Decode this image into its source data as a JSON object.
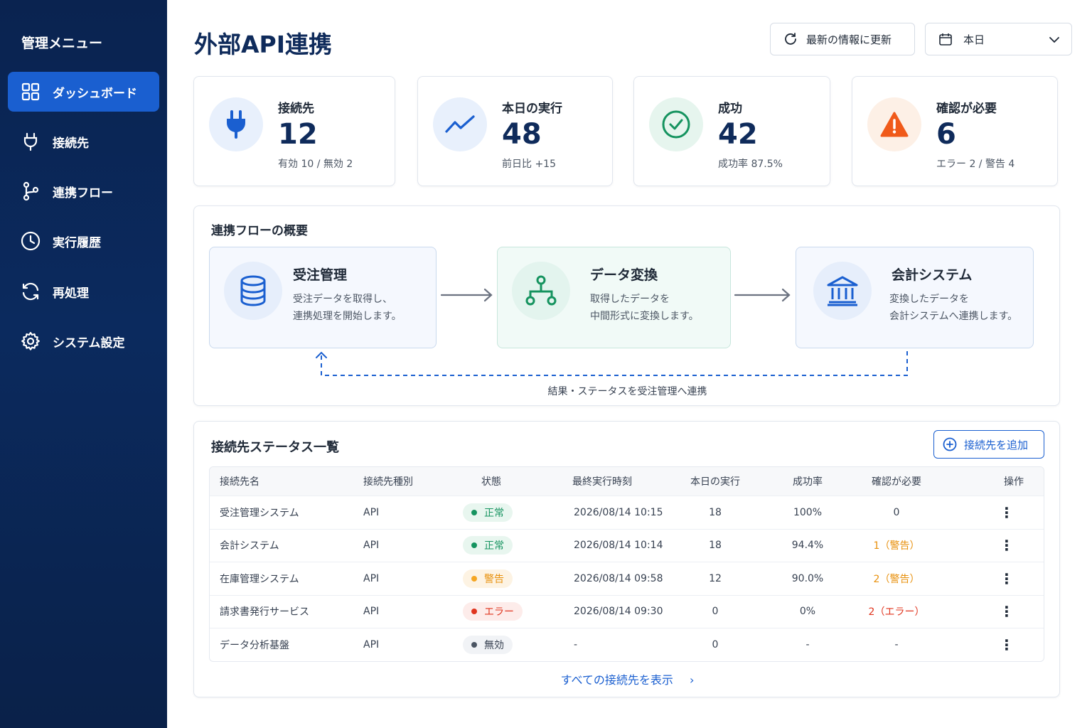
{
  "sidebar": {
    "title": "管理メニュー",
    "items": [
      {
        "label": "ダッシュボード",
        "icon": "grid-icon",
        "active": true
      },
      {
        "label": "接続先",
        "icon": "plug-icon",
        "active": false
      },
      {
        "label": "連携フロー",
        "icon": "branch-icon",
        "active": false
      },
      {
        "label": "実行履歴",
        "icon": "clock-icon",
        "active": false
      },
      {
        "label": "再処理",
        "icon": "refresh-icon",
        "active": false
      },
      {
        "label": "システム設定",
        "icon": "gear-icon",
        "active": false
      }
    ]
  },
  "header": {
    "title": "外部API連携",
    "refresh_label": "最新の情報に更新",
    "date_select": "本日"
  },
  "stats": [
    {
      "label": "接続先",
      "value": "12",
      "sub": "有効 10 / 無効 2",
      "icon": "plug-icon",
      "color": "#1a5fd0"
    },
    {
      "label": "本日の実行",
      "value": "48",
      "sub": "前日比 +15",
      "icon": "trend-icon",
      "color": "#1a5fd0"
    },
    {
      "label": "成功",
      "value": "42",
      "sub": "成功率 87.5%",
      "icon": "check-circle-icon",
      "color": "#15935f"
    },
    {
      "label": "確認が必要",
      "value": "6",
      "sub": "エラー 2 / 警告 4",
      "icon": "warning-icon",
      "color": "#f05a1a"
    }
  ],
  "flow": {
    "title": "連携フローの概要",
    "steps": [
      {
        "title": "受注管理",
        "desc1": "受注データを取得し、",
        "desc2": "連携処理を開始します。",
        "icon": "database-icon"
      },
      {
        "title": "データ変換",
        "desc1": "取得したデータを",
        "desc2": "中間形式に変換します。",
        "icon": "hierarchy-icon"
      },
      {
        "title": "会計システム",
        "desc1": "変換したデータを",
        "desc2": "会計システムへ連携します。",
        "icon": "bank-icon"
      }
    ],
    "feedback": "結果・ステータスを受注管理へ連携"
  },
  "table": {
    "title": "接続先ステータス一覧",
    "add_label": "接続先を追加",
    "headers": [
      "接続先名",
      "接続先種別",
      "状態",
      "最終実行時刻",
      "本日の実行",
      "成功率",
      "確認が必要",
      "操作"
    ],
    "rows": [
      {
        "name": "受注管理システム",
        "type": "API",
        "status": "正常",
        "status_color": "#15935f",
        "status_bg": "#e8f6ef",
        "last": "2026/08/14 10:15",
        "runs": "18",
        "rate": "100%",
        "check": "0",
        "check_color": "#374151"
      },
      {
        "name": "会計システム",
        "type": "API",
        "status": "正常",
        "status_color": "#15935f",
        "status_bg": "#e8f6ef",
        "last": "2026/08/14 10:14",
        "runs": "18",
        "rate": "94.4%",
        "check": "1（警告）",
        "check_color": "#e8900c"
      },
      {
        "name": "在庫管理システム",
        "type": "API",
        "status": "警告",
        "status_color": "#e8900c",
        "status_bg": "#fdf3e3",
        "last": "2026/08/14 09:58",
        "runs": "12",
        "rate": "90.0%",
        "check": "2（警告）",
        "check_color": "#e8900c"
      },
      {
        "name": "請求書発行サービス",
        "type": "API",
        "status": "エラー",
        "status_color": "#e0341e",
        "status_bg": "#fdecea",
        "last": "2026/08/14 09:30",
        "runs": "0",
        "rate": "0%",
        "check": "2（エラー）",
        "check_color": "#e0341e"
      },
      {
        "name": "データ分析基盤",
        "type": "API",
        "status": "無効",
        "status_color": "#4b5563",
        "status_bg": "#f1f3f6",
        "last": "-",
        "runs": "0",
        "rate": "-",
        "check": "-",
        "check_color": "#374151"
      }
    ],
    "show_all": "すべての接続先を表示"
  }
}
